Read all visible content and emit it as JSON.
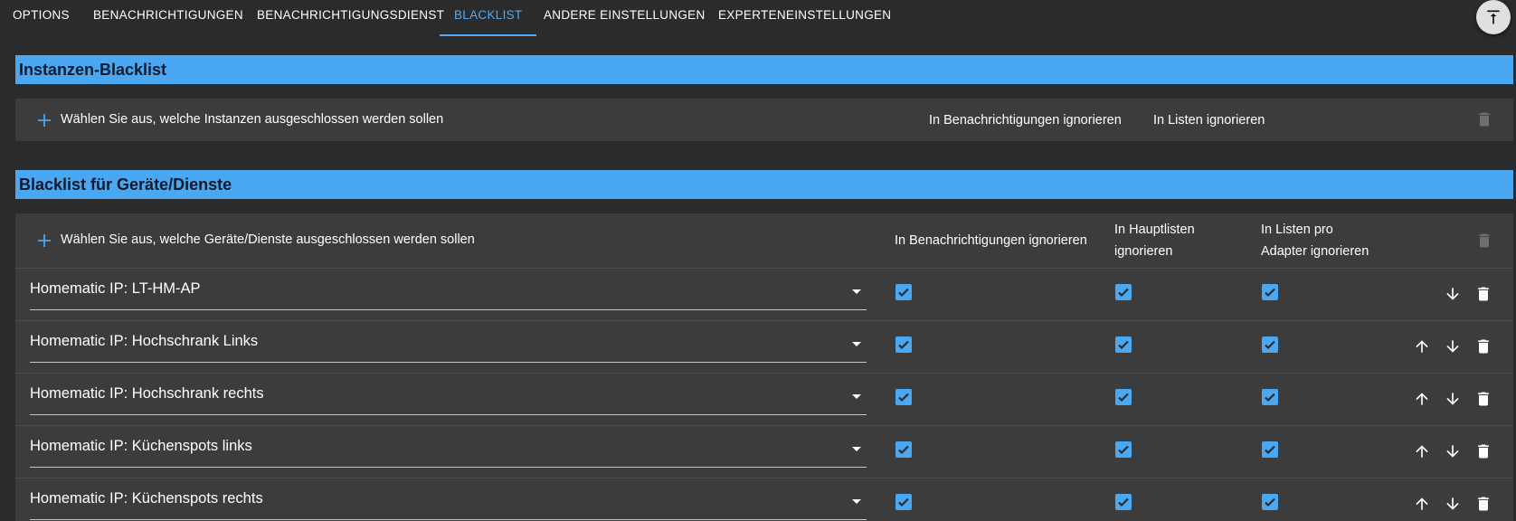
{
  "tabs": [
    {
      "label": "OPTIONS",
      "active": false
    },
    {
      "label": "BENACHRICHTIGUNGEN",
      "active": false
    },
    {
      "label": "BENACHRICHTIGUNGSDIENST",
      "active": false
    },
    {
      "label": "BLACKLIST",
      "active": true
    },
    {
      "label": "ANDERE EINSTELLUNGEN",
      "active": false
    },
    {
      "label": "EXPERTENEINSTELLUNGEN",
      "active": false
    }
  ],
  "colors": {
    "accent": "#4aa8f2",
    "background": "#2b2b2b",
    "panel": "#3c3c3c"
  },
  "instances_section": {
    "title": "Instanzen-Blacklist",
    "add_label": "Wählen Sie aus, welche Instanzen ausgeschlossen werden sollen",
    "col_notifications": "In Benachrichtigungen ignorieren",
    "col_lists": "In Listen ignorieren"
  },
  "devices_section": {
    "title": "Blacklist für Geräte/Dienste",
    "add_label": "Wählen Sie aus, welche Geräte/Dienste ausgeschlossen werden sollen",
    "col_notifications": "In Benachrichtigungen ignorieren",
    "col_main_lists_line1": "In Hauptlisten",
    "col_main_lists_line2": "ignorieren",
    "col_adapter_lists_line1": "In Listen pro",
    "col_adapter_lists_line2": "Adapter ignorieren",
    "rows": [
      {
        "device": "Homematic IP: LT-HM-AP",
        "notifications": true,
        "main_lists": true,
        "adapter_lists": true
      },
      {
        "device": "Homematic IP: Hochschrank Links",
        "notifications": true,
        "main_lists": true,
        "adapter_lists": true
      },
      {
        "device": "Homematic IP: Hochschrank rechts",
        "notifications": true,
        "main_lists": true,
        "adapter_lists": true
      },
      {
        "device": "Homematic IP: Küchenspots links",
        "notifications": true,
        "main_lists": true,
        "adapter_lists": true
      },
      {
        "device": "Homematic IP: Küchenspots rechts",
        "notifications": true,
        "main_lists": true,
        "adapter_lists": true
      }
    ]
  }
}
